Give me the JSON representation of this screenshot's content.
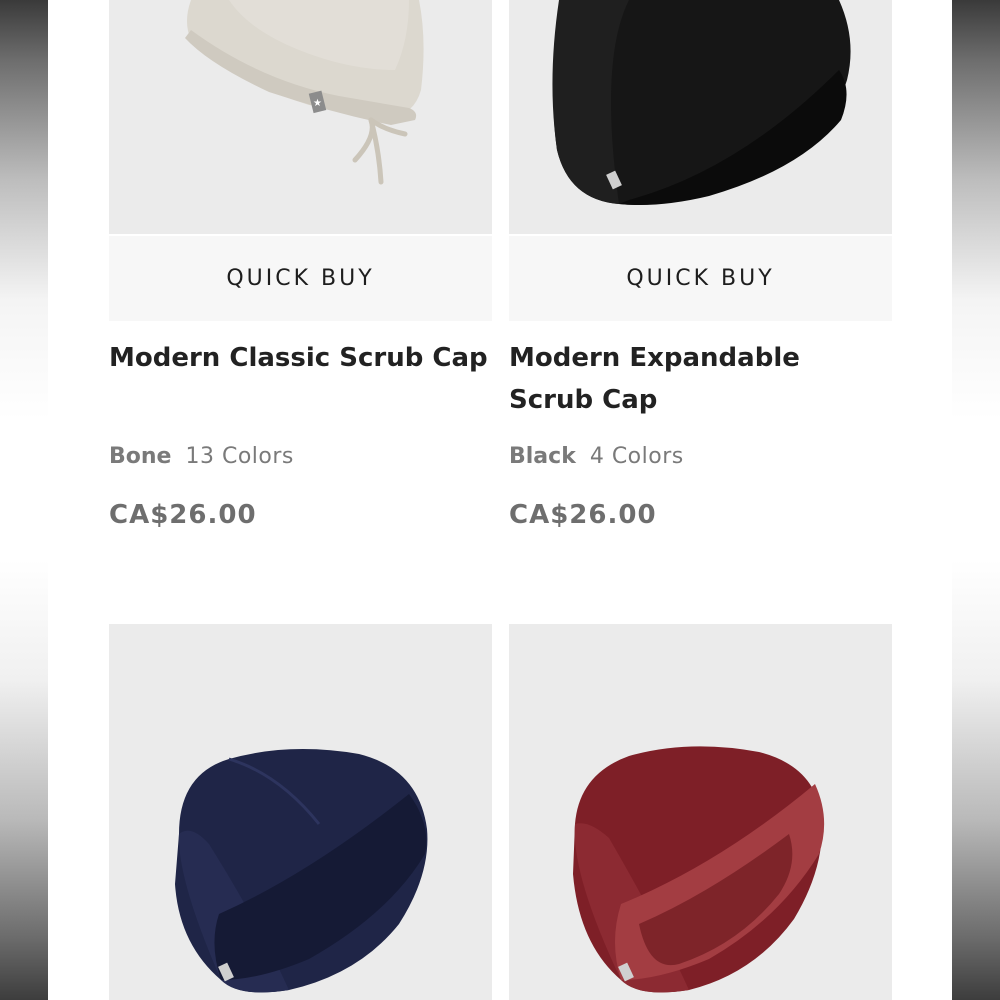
{
  "products": [
    {
      "title": "Modern Classic Scrub Cap",
      "color_name": "Bone",
      "color_count": "13 Colors",
      "price": "CA$26.00",
      "quick_buy": "QUICK BUY",
      "image_icon": "scrub-cap-bone-icon",
      "cap_color": "#d9d5cc"
    },
    {
      "title": "Modern Expandable Scrub Cap",
      "color_name": "Black",
      "color_count": "4 Colors",
      "price": "CA$26.00",
      "quick_buy": "QUICK BUY",
      "image_icon": "scrub-cap-black-icon",
      "cap_color": "#141414"
    },
    {
      "image_icon": "scrub-cap-navy-icon",
      "cap_color": "#1c2244"
    },
    {
      "image_icon": "scrub-cap-burgundy-icon",
      "cap_color": "#7c1e25"
    }
  ]
}
